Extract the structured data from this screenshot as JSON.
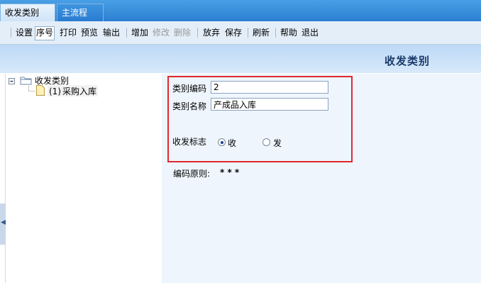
{
  "tabs": [
    {
      "label": "收发类别",
      "close": "✕"
    },
    {
      "label": "主流程"
    }
  ],
  "toolbar": {
    "settings": "设置",
    "sequence": "序号",
    "print": "打印",
    "preview": "预览",
    "export": "输出",
    "add": "增加",
    "modify": "修改",
    "delete": "删除",
    "abandon": "放弃",
    "save": "保存",
    "refresh": "刷新",
    "help": "帮助",
    "exit": "退出"
  },
  "header": {
    "title": "收发类别"
  },
  "tree": {
    "root_label": "收发类别",
    "items": [
      {
        "code": "(1)",
        "label": "采购入库"
      }
    ]
  },
  "form": {
    "code_label": "类别编码",
    "code_value": "2",
    "name_label": "类别名称",
    "name_value": "产成品入库",
    "flag_label": "收发标志",
    "flag_options": [
      "收",
      "发"
    ],
    "flag_selected": "收",
    "rule_label": "编码原则:",
    "rule_value": "* * *"
  }
}
